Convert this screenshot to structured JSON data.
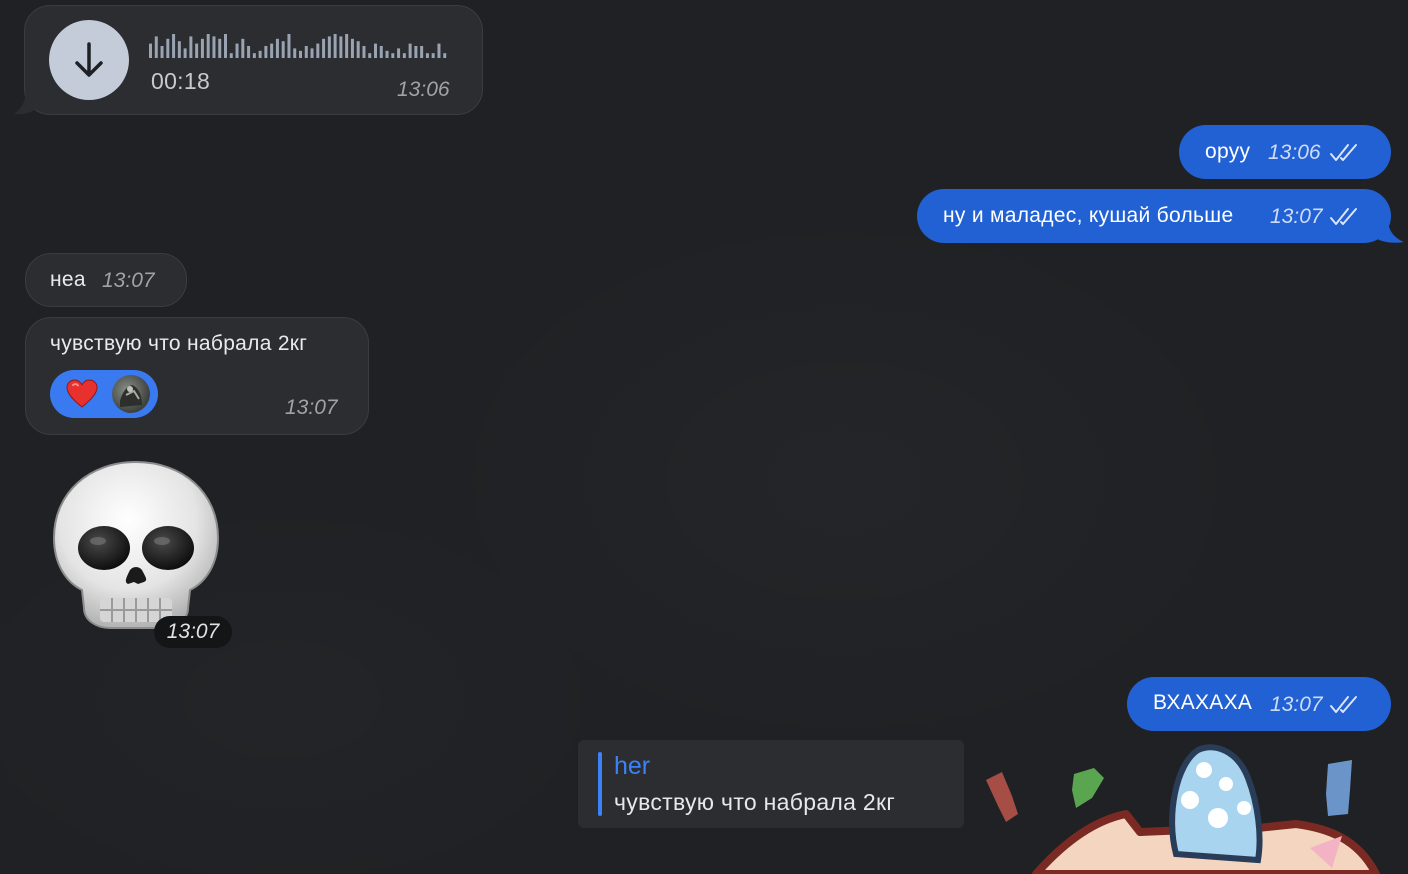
{
  "voice_message": {
    "duration": "00:18",
    "time": "13:06",
    "download_icon": "arrow-down-icon"
  },
  "messages": [
    {
      "id": "out-1",
      "direction": "outgoing",
      "text": "оруу",
      "time": "13:06",
      "status": "read"
    },
    {
      "id": "out-2",
      "direction": "outgoing",
      "text": "ну и маладес, кушай больше",
      "time": "13:07",
      "status": "read"
    },
    {
      "id": "in-1",
      "direction": "incoming",
      "text": "неа",
      "time": "13:07"
    },
    {
      "id": "in-2",
      "direction": "incoming",
      "text": "чувствую что набрала 2кг",
      "time": "13:07",
      "reaction": "heart"
    },
    {
      "id": "out-3",
      "direction": "outgoing",
      "text": "ВХАХАХА",
      "time": "13:07",
      "status": "read"
    }
  ],
  "sticker": {
    "emoji": "skull",
    "time": "13:07"
  },
  "reply": {
    "sender": "her",
    "quoted_text": "чувствую что набрала 2кг"
  },
  "colors": {
    "background": "#1f2124",
    "incoming_bubble": "#2b2d31",
    "outgoing_bubble": "#2161d4",
    "reply_accent": "#3b82f6"
  }
}
